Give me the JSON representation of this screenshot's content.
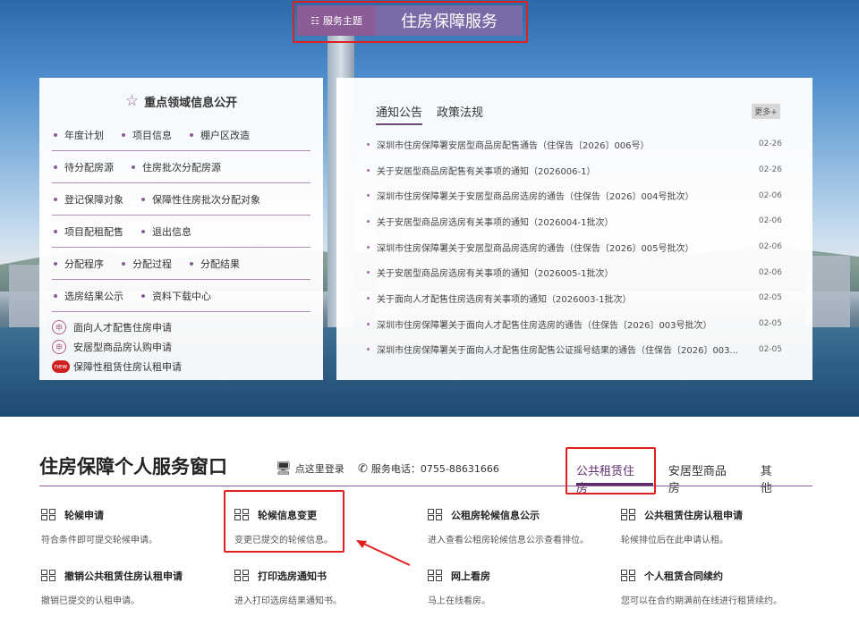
{
  "topic": {
    "tag": "服务主题",
    "title": "住房保障服务"
  },
  "left": {
    "title": "重点领域信息公开",
    "rows": [
      [
        "年度计划",
        "项目信息",
        "棚户区改造"
      ],
      [
        "待分配房源",
        "住房批次分配房源"
      ],
      [
        "登记保障对象",
        "保障性住房批次分配对象"
      ],
      [
        "项目配租配售",
        "退出信息"
      ],
      [
        "分配程序",
        "分配过程",
        "分配结果"
      ],
      [
        "选房结果公示",
        "资料下载中心"
      ]
    ],
    "apps": [
      "面向人才配售住房申请",
      "安居型商品房认购申请",
      "保障性租赁住房认租申请"
    ],
    "new_badge": "new"
  },
  "right": {
    "tabs": [
      "通知公告",
      "政策法规"
    ],
    "more": "更多+",
    "notices": [
      {
        "t": "深圳市住房保障署安居型商品房配售通告（住保告〔2026〕006号）",
        "d": "02-26"
      },
      {
        "t": "关于安居型商品房配售有关事项的通知（2026006-1）",
        "d": "02-26"
      },
      {
        "t": "深圳市住房保障署关于安居型商品房选房的通告（住保告〔2026〕004号批次）",
        "d": "02-06"
      },
      {
        "t": "关于安居型商品房选房有关事项的通知（2026004-1批次）",
        "d": "02-06"
      },
      {
        "t": "深圳市住房保障署关于安居型商品房选房的通告（住保告〔2026〕005号批次）",
        "d": "02-06"
      },
      {
        "t": "关于安居型商品房选房有关事项的通知（2026005-1批次）",
        "d": "02-06"
      },
      {
        "t": "关于面向人才配售住房选房有关事项的通知（2026003-1批次）",
        "d": "02-05"
      },
      {
        "t": "深圳市住房保障署关于面向人才配售住房选房的通告（住保告〔2026〕003号批次）",
        "d": "02-05"
      },
      {
        "t": "深圳市住房保障署关于面向人才配售住房配售公证摇号结果的通告（住保告〔2026〕003...",
        "d": "02-05"
      }
    ]
  },
  "lower": {
    "title": "住房保障个人服务窗口",
    "login": "点这里登录",
    "phone": "服务电话：0755-88631666",
    "tabs": [
      "公共租赁住房",
      "安居型商品房",
      "其他"
    ],
    "services": [
      {
        "h": "轮候申请",
        "s": "符合条件即可提交轮候申请。"
      },
      {
        "h": "轮候信息变更",
        "s": "变更已提交的轮候信息。"
      },
      {
        "h": "公租房轮候信息公示",
        "s": "进入查看公租房轮候信息公示查看排位。"
      },
      {
        "h": "公共租赁住房认租申请",
        "s": "轮候排位后在此申请认租。"
      },
      {
        "h": "撤销公共租赁住房认租申请",
        "s": "撤销已提交的认租申请。"
      },
      {
        "h": "打印选房通知书",
        "s": "进入打印选房结果通知书。"
      },
      {
        "h": "网上看房",
        "s": "马上在线看房。"
      },
      {
        "h": "个人租赁合同续约",
        "s": "您可以在合约期满前在线进行租赁续约。"
      }
    ]
  }
}
